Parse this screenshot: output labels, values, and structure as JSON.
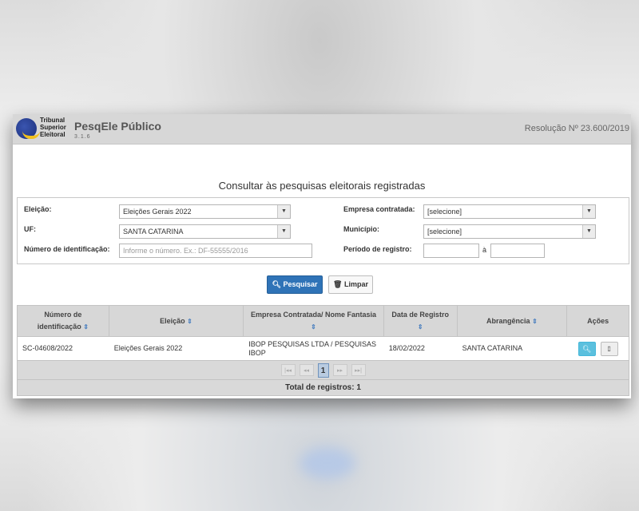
{
  "header": {
    "logo_lines": [
      "Tribunal",
      "Superior",
      "Eleitoral"
    ],
    "app_title": "PesqEle Público",
    "version": "3.1.6",
    "resolution": "Resolução Nº 23.600/2019"
  },
  "page_title": "Consultar às pesquisas eleitorais registradas",
  "filters": {
    "eleicao": {
      "label": "Eleição:",
      "value": "Eleições Gerais 2022"
    },
    "uf": {
      "label": "UF:",
      "value": "SANTA CATARINA"
    },
    "numero": {
      "label": "Número de identificação:",
      "placeholder": "Informe o número. Ex.: DF-55555/2016"
    },
    "empresa": {
      "label": "Empresa contratada:",
      "value": "[selecione]"
    },
    "municipio": {
      "label": "Município:",
      "value": "[selecione]"
    },
    "periodo": {
      "label": "Período de registro:",
      "separator": "à",
      "start": "",
      "end": ""
    }
  },
  "buttons": {
    "search": "Pesquisar",
    "clear": "Limpar"
  },
  "table": {
    "columns": [
      {
        "line1": "Número de",
        "line2": "identificação"
      },
      {
        "line1": "Eleição",
        "line2": ""
      },
      {
        "line1": "Empresa Contratada/ Nome Fantasia",
        "line2": ""
      },
      {
        "line1": "Data de Registro",
        "line2": ""
      },
      {
        "line1": "Abrangência",
        "line2": ""
      },
      {
        "line1": "Ações",
        "line2": ""
      }
    ],
    "rows": [
      {
        "numero": "SC-04608/2022",
        "eleicao": "Eleições Gerais 2022",
        "empresa": "IBOP PESQUISAS LTDA / PESQUISAS IBOP",
        "data": "18/02/2022",
        "abrangencia": "SANTA CATARINA"
      }
    ]
  },
  "pagination": {
    "current_page": "1"
  },
  "total": "Total de registros: 1",
  "colors": {
    "primary": "#2f73b7",
    "info": "#5bc0de",
    "header_bg": "#d7d7d7"
  }
}
